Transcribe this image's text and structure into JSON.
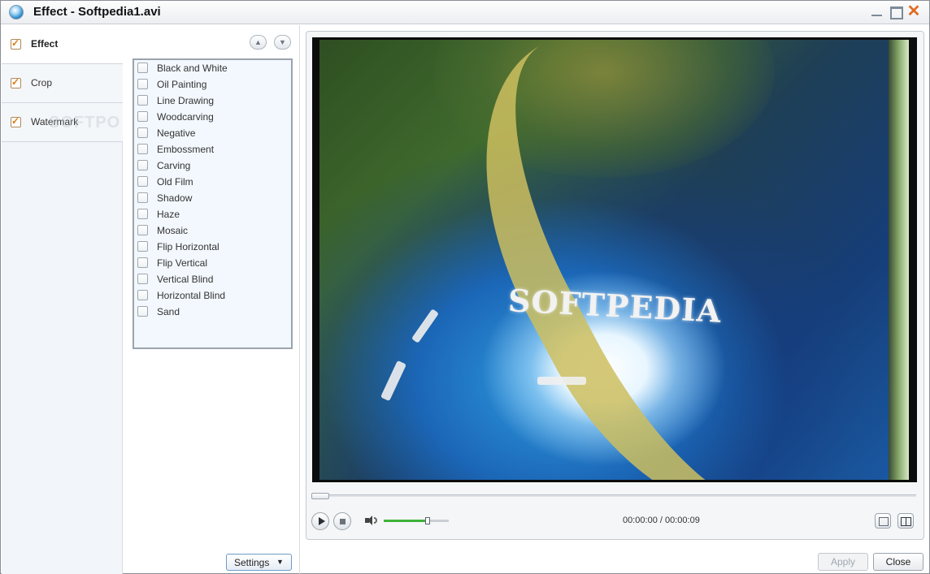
{
  "window": {
    "title": "Effect - Softpedia1.avi",
    "icon": "app-globe-icon",
    "controls": [
      "minimize-icon",
      "maximize-icon",
      "close-icon"
    ],
    "close_glyph": "✕"
  },
  "tabs": [
    {
      "label": "Effect",
      "checked": true,
      "active": true
    },
    {
      "label": "Crop",
      "checked": true,
      "active": false
    },
    {
      "label": "Watermark",
      "checked": true,
      "active": false
    }
  ],
  "watermark_ghost": "SOFTPO",
  "effect_list": {
    "scroll_up_icon": "▲",
    "scroll_down_icon": "▼",
    "items": [
      {
        "label": "Black and White",
        "checked": false
      },
      {
        "label": "Oil Painting",
        "checked": false
      },
      {
        "label": "Line Drawing",
        "checked": false
      },
      {
        "label": "Woodcarving",
        "checked": false
      },
      {
        "label": "Negative",
        "checked": false
      },
      {
        "label": "Embossment",
        "checked": false
      },
      {
        "label": "Carving",
        "checked": false
      },
      {
        "label": "Old Film",
        "checked": false
      },
      {
        "label": "Shadow",
        "checked": false
      },
      {
        "label": "Haze",
        "checked": false
      },
      {
        "label": "Mosaic",
        "checked": false
      },
      {
        "label": "Flip Horizontal",
        "checked": false
      },
      {
        "label": "Flip Vertical",
        "checked": false
      },
      {
        "label": "Vertical Blind",
        "checked": false
      },
      {
        "label": "Horizontal Blind",
        "checked": false
      },
      {
        "label": "Sand",
        "checked": false
      }
    ]
  },
  "settings_button": {
    "label": "Settings",
    "dropdown_icon": "▼"
  },
  "preview": {
    "video_overlay_text": "SOFTPEDIA",
    "seek_progress": 0.0,
    "volume_level": 0.68,
    "time_display": "00:00:00 / 00:00:09"
  },
  "buttons": {
    "apply": "Apply",
    "close": "Close"
  },
  "colors": {
    "checkbox_accent": "#e07a12",
    "volume_fill": "#3fb23a",
    "close_accent": "#e06b1e"
  }
}
